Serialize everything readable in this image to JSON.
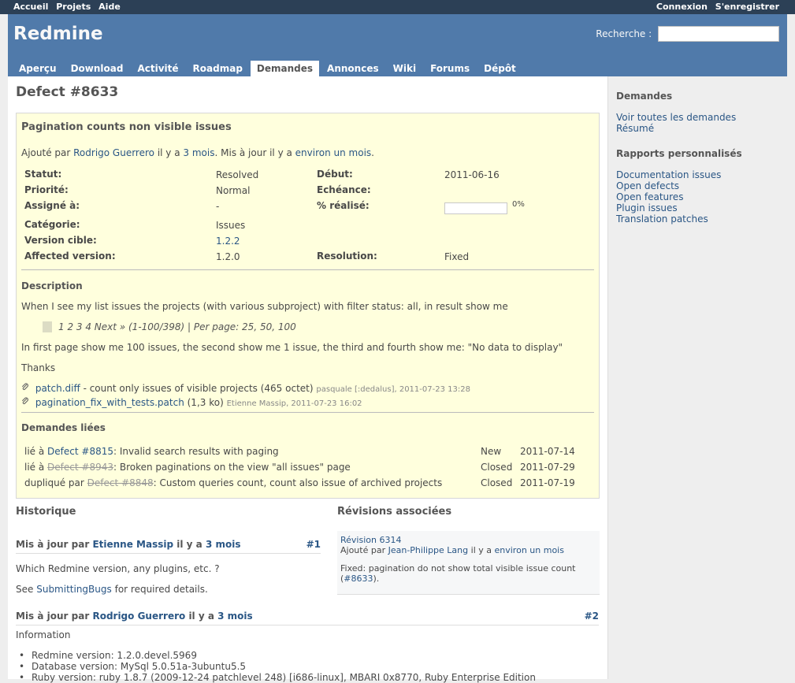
{
  "top_menu": {
    "left": [
      "Accueil",
      "Projets",
      "Aide"
    ],
    "right": [
      "Connexion",
      "S'enregistrer"
    ]
  },
  "header": {
    "title": "Redmine",
    "search_label": "Recherche :"
  },
  "tabs": [
    "Aperçu",
    "Download",
    "Activité",
    "Roadmap",
    "Demandes",
    "Annonces",
    "Wiki",
    "Forums",
    "Dépôt"
  ],
  "selected_tab": "Demandes",
  "issue": {
    "heading": "Defect #8633",
    "subject": "Pagination counts non visible issues",
    "author": {
      "prefix": "Ajouté par",
      "name": "Rodrigo Guerrero",
      "mid1": "il y a",
      "ago": "3 mois",
      "mid2": ". Mis à jour il y a",
      "updated": "environ un mois",
      "end": "."
    },
    "attributes": {
      "status_label": "Statut:",
      "status": "Resolved",
      "start_label": "Début:",
      "start": "2011-06-16",
      "priority_label": "Priorité:",
      "priority": "Normal",
      "due_label": "Echéance:",
      "assignee_label": "Assigné à:",
      "assignee": "-",
      "done_label": "% réalisé:",
      "done_pct": "0%",
      "done_value": 0,
      "category_label": "Catégorie:",
      "category": "Issues",
      "target_label": "Version cible:",
      "target": "1.2.2",
      "affected_label": "Affected version:",
      "affected": "1.2.0",
      "resolution_label": "Resolution:",
      "resolution": "Fixed"
    },
    "description_title": "Description",
    "description": {
      "p1": "When I see my list issues the projects (with various subproject) with filter status: all, in result show me",
      "quote": "1 2 3 4 Next » (1-100/398) | Per page: 25, 50, 100",
      "p2": "In first page show me 100 issues, the second show me 1 issue, the third and fourth show me: \"No data to display\"",
      "p3": "Thanks"
    },
    "attachments": [
      {
        "name": "patch.diff",
        "desc": " - count only issues of visible projects (465 octet)",
        "meta": "pasquale [:dedalus], 2011-07-23 13:28"
      },
      {
        "name": "pagination_fix_with_tests.patch",
        "desc": " (1,3 ko)",
        "meta": "Etienne Massip, 2011-07-23 16:02"
      }
    ],
    "relations_title": "Demandes liées",
    "relations": [
      {
        "type": "lié à",
        "link": "Defect #8815",
        "text": ": Invalid search results with paging",
        "status": "New",
        "date": "2011-07-14"
      },
      {
        "type": "lié à",
        "link": "Defect #8943",
        "text": ": Broken paginations on the view \"all issues\" page",
        "status": "Closed",
        "date": "2011-07-29"
      },
      {
        "type": "dupliqué par",
        "link": "Defect #8848",
        "text": ": Custom queries count, count also issue of archived projects",
        "status": "Closed",
        "date": "2011-07-19"
      }
    ]
  },
  "history": {
    "title": "Historique",
    "journals": [
      {
        "prefix": "Mis à jour par",
        "author": "Etienne Massip",
        "mid": "il y a",
        "ago": "3 mois",
        "num": "#1",
        "lines": [
          "Which Redmine version, any plugins, etc. ?"
        ],
        "see": "See",
        "see_link": "SubmittingBugs",
        "see_end": "for required details."
      },
      {
        "prefix": "Mis à jour par",
        "author": "Rodrigo Guerrero",
        "mid": "il y a",
        "ago": "3 mois",
        "num": "#2",
        "info": "Information",
        "bullets": [
          "Redmine version: 1.2.0.devel.5969",
          "Database version: MySql 5.0.51a-3ubuntu5.5",
          "Ruby version: ruby 1.8.7 (2009-12-24 patchlevel 248) [i686-linux], MBARI 0x8770, Ruby Enterprise Edition"
        ]
      }
    ]
  },
  "revisions": {
    "title": "Révisions associées",
    "link": "Révision 6314",
    "added_prefix": "Ajouté par",
    "author": "Jean-Philippe Lang",
    "mid": "il y a",
    "ago": "environ un mois",
    "msg": "Fixed: pagination do not show total visible issue count",
    "ref_open": "(",
    "ref": "#8633",
    "ref_close": ")."
  },
  "sidebar": {
    "title1": "Demandes",
    "links1": [
      "Voir toutes les demandes",
      "Résumé"
    ],
    "title2": "Rapports personnalisés",
    "links2": [
      "Documentation issues",
      "Open defects",
      "Open features",
      "Plugin issues",
      "Translation patches"
    ]
  },
  "colors": {
    "top_bar": "#2C4056",
    "header": "#507AAA",
    "issue_bg": "#FFFFDD",
    "link": "#2A5685"
  }
}
